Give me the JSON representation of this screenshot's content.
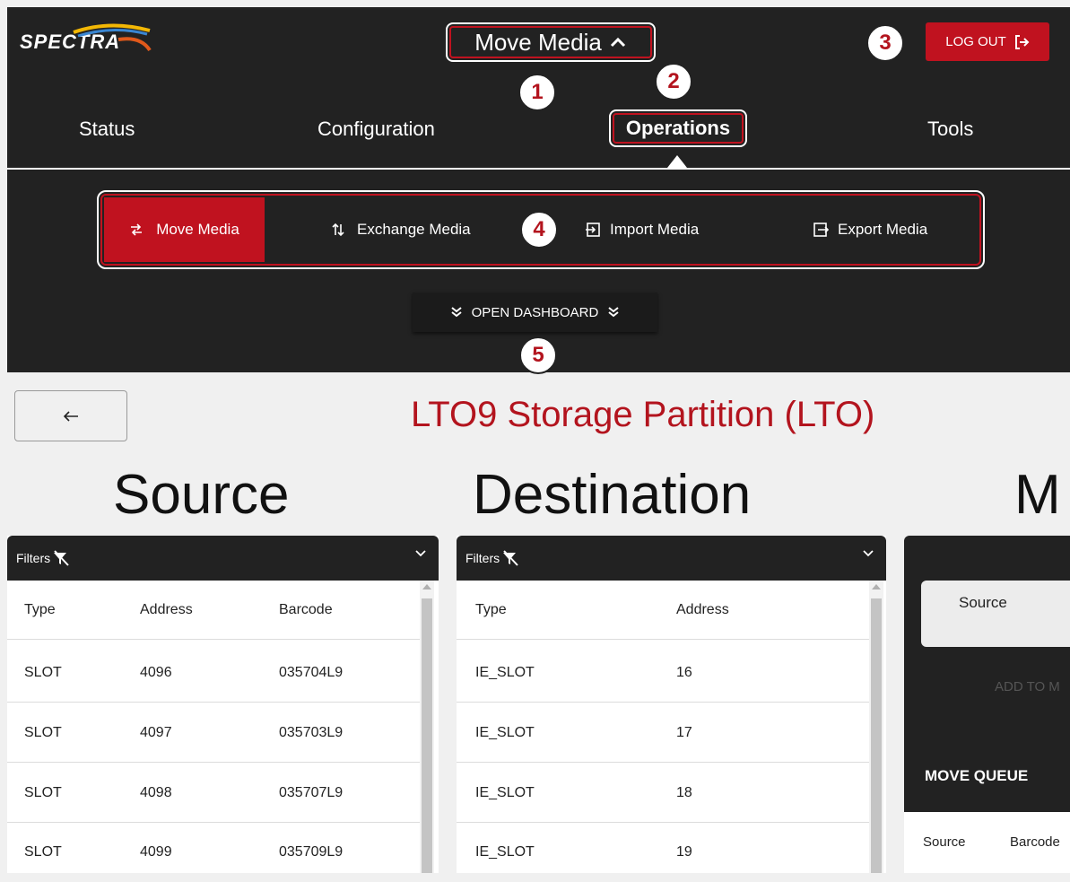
{
  "header": {
    "logo_text": "SPECTRA",
    "page_title": "Move Media",
    "logout_label": "LOG OUT",
    "nav": [
      "Status",
      "Configuration",
      "Operations",
      "Tools"
    ],
    "subnav": [
      "Move Media",
      "Exchange Media",
      "Import Media",
      "Export Media"
    ],
    "dashboard_label": "OPEN DASHBOARD"
  },
  "callouts": [
    "1",
    "2",
    "3",
    "4",
    "5"
  ],
  "main": {
    "partition_title": "LTO9 Storage Partition (LTO)",
    "source_heading": "Source",
    "destination_heading": "Destination",
    "move_heading": "M"
  },
  "source_table": {
    "filters_label": "Filters",
    "columns": [
      "Type",
      "Address",
      "Barcode"
    ],
    "rows": [
      [
        "SLOT",
        "4096",
        "035704L9"
      ],
      [
        "SLOT",
        "4097",
        "035703L9"
      ],
      [
        "SLOT",
        "4098",
        "035707L9"
      ],
      [
        "SLOT",
        "4099",
        "035709L9"
      ]
    ]
  },
  "destination_table": {
    "filters_label": "Filters",
    "columns": [
      "Type",
      "Address"
    ],
    "rows": [
      [
        "IE_SLOT",
        "16"
      ],
      [
        "IE_SLOT",
        "17"
      ],
      [
        "IE_SLOT",
        "18"
      ],
      [
        "IE_SLOT",
        "19"
      ]
    ]
  },
  "move_panel": {
    "source_label": "Source",
    "add_label": "ADD TO M",
    "queue_label": "MOVE QUEUE",
    "queue_columns": [
      "Source",
      "Barcode"
    ]
  },
  "colors": {
    "accent": "#c0121f",
    "header_bg": "#222222",
    "page_bg": "#f0f0f0"
  }
}
